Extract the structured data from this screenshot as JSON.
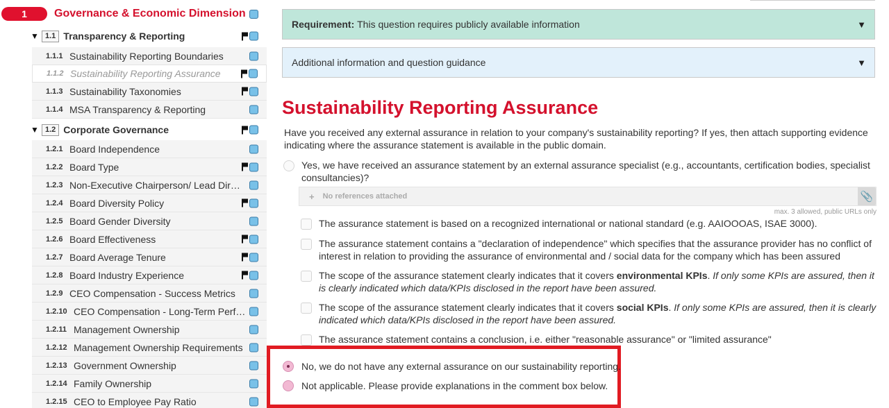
{
  "sidebar": {
    "section": {
      "number": "1",
      "title": "Governance & Economic Dimension"
    },
    "groups": [
      {
        "number": "1.1",
        "title": "Transparency & Reporting",
        "items": [
          {
            "number": "1.1.1",
            "label": "Sustainability Reporting Boundaries",
            "flag": false
          },
          {
            "number": "1.1.2",
            "label": "Sustainability Reporting Assurance",
            "flag": true,
            "active": true
          },
          {
            "number": "1.1.3",
            "label": "Sustainability Taxonomies",
            "flag": true
          },
          {
            "number": "1.1.4",
            "label": "MSA Transparency & Reporting",
            "flag": false
          }
        ]
      },
      {
        "number": "1.2",
        "title": "Corporate Governance",
        "items": [
          {
            "number": "1.2.1",
            "label": "Board Independence",
            "flag": false
          },
          {
            "number": "1.2.2",
            "label": "Board Type",
            "flag": true
          },
          {
            "number": "1.2.3",
            "label": "Non-Executive Chairperson/ Lead Dire…",
            "flag": false
          },
          {
            "number": "1.2.4",
            "label": "Board Diversity Policy",
            "flag": true
          },
          {
            "number": "1.2.5",
            "label": "Board Gender Diversity",
            "flag": false
          },
          {
            "number": "1.2.6",
            "label": "Board Effectiveness",
            "flag": true
          },
          {
            "number": "1.2.7",
            "label": "Board Average Tenure",
            "flag": true
          },
          {
            "number": "1.2.8",
            "label": "Board Industry Experience",
            "flag": true
          },
          {
            "number": "1.2.9",
            "label": "CEO Compensation - Success Metrics",
            "flag": false
          },
          {
            "number": "1.2.10",
            "label": "CEO Compensation - Long-Term Perf…",
            "flag": false
          },
          {
            "number": "1.2.11",
            "label": "Management Ownership",
            "flag": false
          },
          {
            "number": "1.2.12",
            "label": "Management Ownership Requirements",
            "flag": false
          },
          {
            "number": "1.2.13",
            "label": "Government Ownership",
            "flag": false
          },
          {
            "number": "1.2.14",
            "label": "Family Ownership",
            "flag": false
          },
          {
            "number": "1.2.15",
            "label": "CEO to Employee Pay Ratio",
            "flag": false
          }
        ]
      }
    ]
  },
  "main": {
    "requirement": {
      "label": "Requirement:",
      "text": "This question requires publicly available information"
    },
    "guidance": "Additional information and question guidance",
    "question_title": "Sustainability Reporting Assurance",
    "question_text": "Have you received any external assurance in relation to your company's sustainability reporting? If yes, then attach supporting evidence indicating where the assurance statement is available in the public domain.",
    "option_yes": "Yes, we have received an assurance statement by an external assurance specialist (e.g., accountants, certification bodies, specialist consultancies)?",
    "references": {
      "placeholder": "No references attached",
      "note": "max. 3 allowed, public URLs only"
    },
    "checkboxes": [
      {
        "text": "The assurance statement is based on a recognized international or national standard (e.g. AAIOOOAS, ISAE 3000)."
      },
      {
        "text": "The assurance statement contains a \"declaration of independence\" which specifies that the assurance provider has no conflict of interest in relation to providing the assurance of environmental and / social data for the company which has been assured"
      },
      {
        "pre": "The scope of the assurance statement clearly indicates that it covers ",
        "bold": "environmental KPIs",
        "post": ". ",
        "italic": "If only some KPIs are assured, then it is clearly indicated which data/KPIs disclosed in the report have been assured."
      },
      {
        "pre": "The scope of the assurance statement clearly indicates that it covers ",
        "bold": "social KPIs",
        "post": ". ",
        "italic": "If only some KPIs are assured, then it is clearly indicated which data/KPIs disclosed in the report have been assured."
      },
      {
        "text": "The assurance statement contains a conclusion, i.e. either \"reasonable assurance\" or \"limited assurance\""
      }
    ],
    "option_no": "No, we do not have any external assurance on our sustainability reporting.",
    "option_na": "Not applicable. Please provide explanations in the comment box below.",
    "colors": {
      "accent_red": "#d4112d",
      "highlight_box": "#e11b22",
      "requirement_bg": "#bfe6da",
      "guidance_bg": "#e3f1fb"
    }
  }
}
